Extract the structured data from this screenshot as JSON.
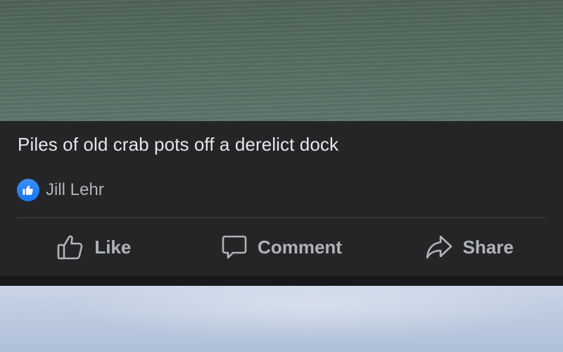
{
  "post": {
    "caption": "Piles of old crab pots off a derelict dock",
    "reactions": {
      "icon": "like-icon",
      "color": "#1877f2",
      "name": "Jill Lehr"
    }
  },
  "actions": {
    "like": {
      "label": "Like",
      "icon": "thumbs-up-icon"
    },
    "comment": {
      "label": "Comment",
      "icon": "speech-bubble-icon"
    },
    "share": {
      "label": "Share",
      "icon": "share-arrow-icon"
    }
  },
  "colors": {
    "card_background": "#242526",
    "page_background": "#18191a",
    "text_primary": "#e4e6eb",
    "text_secondary": "#b0b3b8"
  }
}
